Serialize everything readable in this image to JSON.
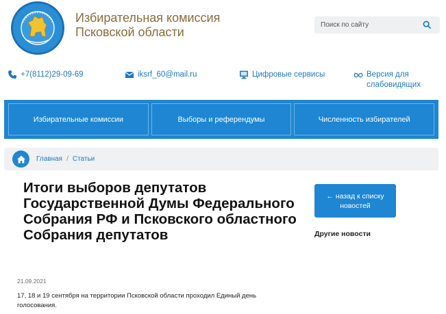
{
  "header": {
    "title_line1": "Избирательная комиссия",
    "title_line2": "Псковской области",
    "logo_icon": "coat-of-arms-logo"
  },
  "search": {
    "placeholder": "Поиск по сайту",
    "icon": "search-icon"
  },
  "contacts": {
    "phone": "+7(8112)29-09-69",
    "email": "iksrf_60@mail.ru",
    "digital": "Цифровые сервисы",
    "vision_line1": "Версия для",
    "vision_line2": "слабовидящих"
  },
  "nav": {
    "items": [
      "Избирательные комиссии",
      "Выборы и референдумы",
      "Численность избирателей"
    ]
  },
  "breadcrumb": {
    "home": "Главная",
    "separator": "/",
    "current": "Статьи"
  },
  "article": {
    "title": "Итоги выборов депутатов Государственной Думы Федерального Собрания РФ и Псковского областного Собрания депутатов",
    "date": "21.09.2021",
    "lead": "17, 18 и 19 сентября на территории Псковской области проходил Единый день голосования."
  },
  "sidebar": {
    "back_button": "← назад к списку новостей",
    "other_news": "Другие новости"
  },
  "colors": {
    "accent": "#1e86d2",
    "title_brown": "#8a6d3b",
    "link": "#1e78c2"
  }
}
